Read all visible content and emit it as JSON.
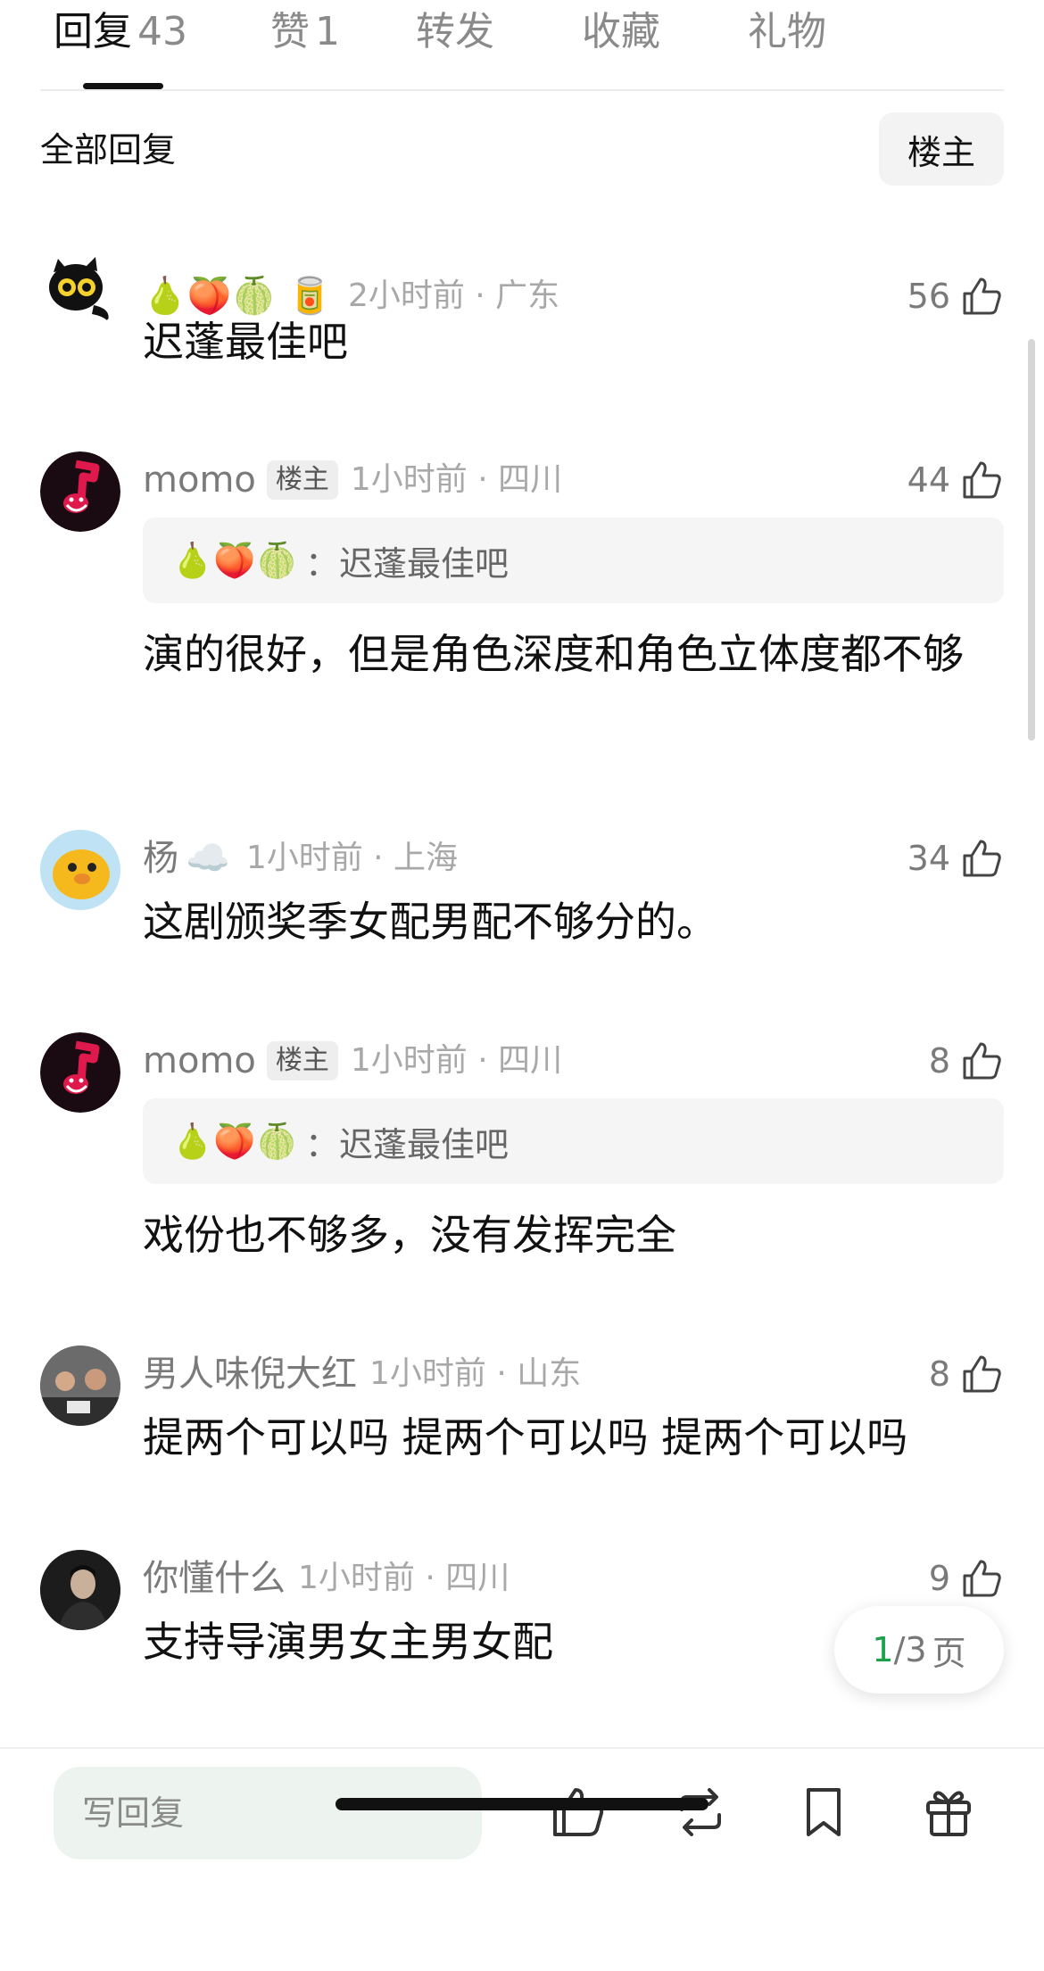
{
  "tabs": [
    {
      "label": "回复",
      "count": "43"
    },
    {
      "label": "赞",
      "count": "1"
    },
    {
      "label": "转发",
      "count": ""
    },
    {
      "label": "收藏",
      "count": ""
    },
    {
      "label": "礼物",
      "count": ""
    }
  ],
  "section": {
    "title": "全部回复",
    "owner_filter": "楼主"
  },
  "comments": [
    {
      "name": "",
      "emoji": "🍐🍑🍈 🥫",
      "time": "2小时前 · 广东",
      "likes": "56",
      "text": "迟蓬最佳吧"
    },
    {
      "name": "momo",
      "badge": "楼主",
      "time": "1小时前 · 四川",
      "likes": "44",
      "quote_emoji": "🍐🍑🍈",
      "quote_text": "：迟蓬最佳吧",
      "text": "演的很好，但是角色深度和角色立体度都不够"
    },
    {
      "name": "杨",
      "emoji": "☁️",
      "time": "1小时前 · 上海",
      "likes": "34",
      "text": "这剧颁奖季女配男配不够分的。"
    },
    {
      "name": "momo",
      "badge": "楼主",
      "time": "1小时前 · 四川",
      "likes": "8",
      "quote_emoji": "🍐🍑🍈",
      "quote_text": "：迟蓬最佳吧",
      "text": "戏份也不够多，没有发挥完全"
    },
    {
      "name": "男人味倪大红",
      "time": "1小时前 · 山东",
      "likes": "8",
      "text": "提两个可以吗 提两个可以吗 提两个可以吗"
    },
    {
      "name": "你懂什么",
      "time": "1小时前 · 四川",
      "likes": "9",
      "text": "支持导演男女主男女配"
    }
  ],
  "pagination": {
    "current": "1",
    "total": "/3",
    "unit": "页"
  },
  "bottom_bar": {
    "reply_placeholder": "写回复"
  },
  "colors": {
    "accent_green": "#1aa14a",
    "text_gray": "#7a7a7a",
    "quote_bg": "#f5f5f5"
  }
}
